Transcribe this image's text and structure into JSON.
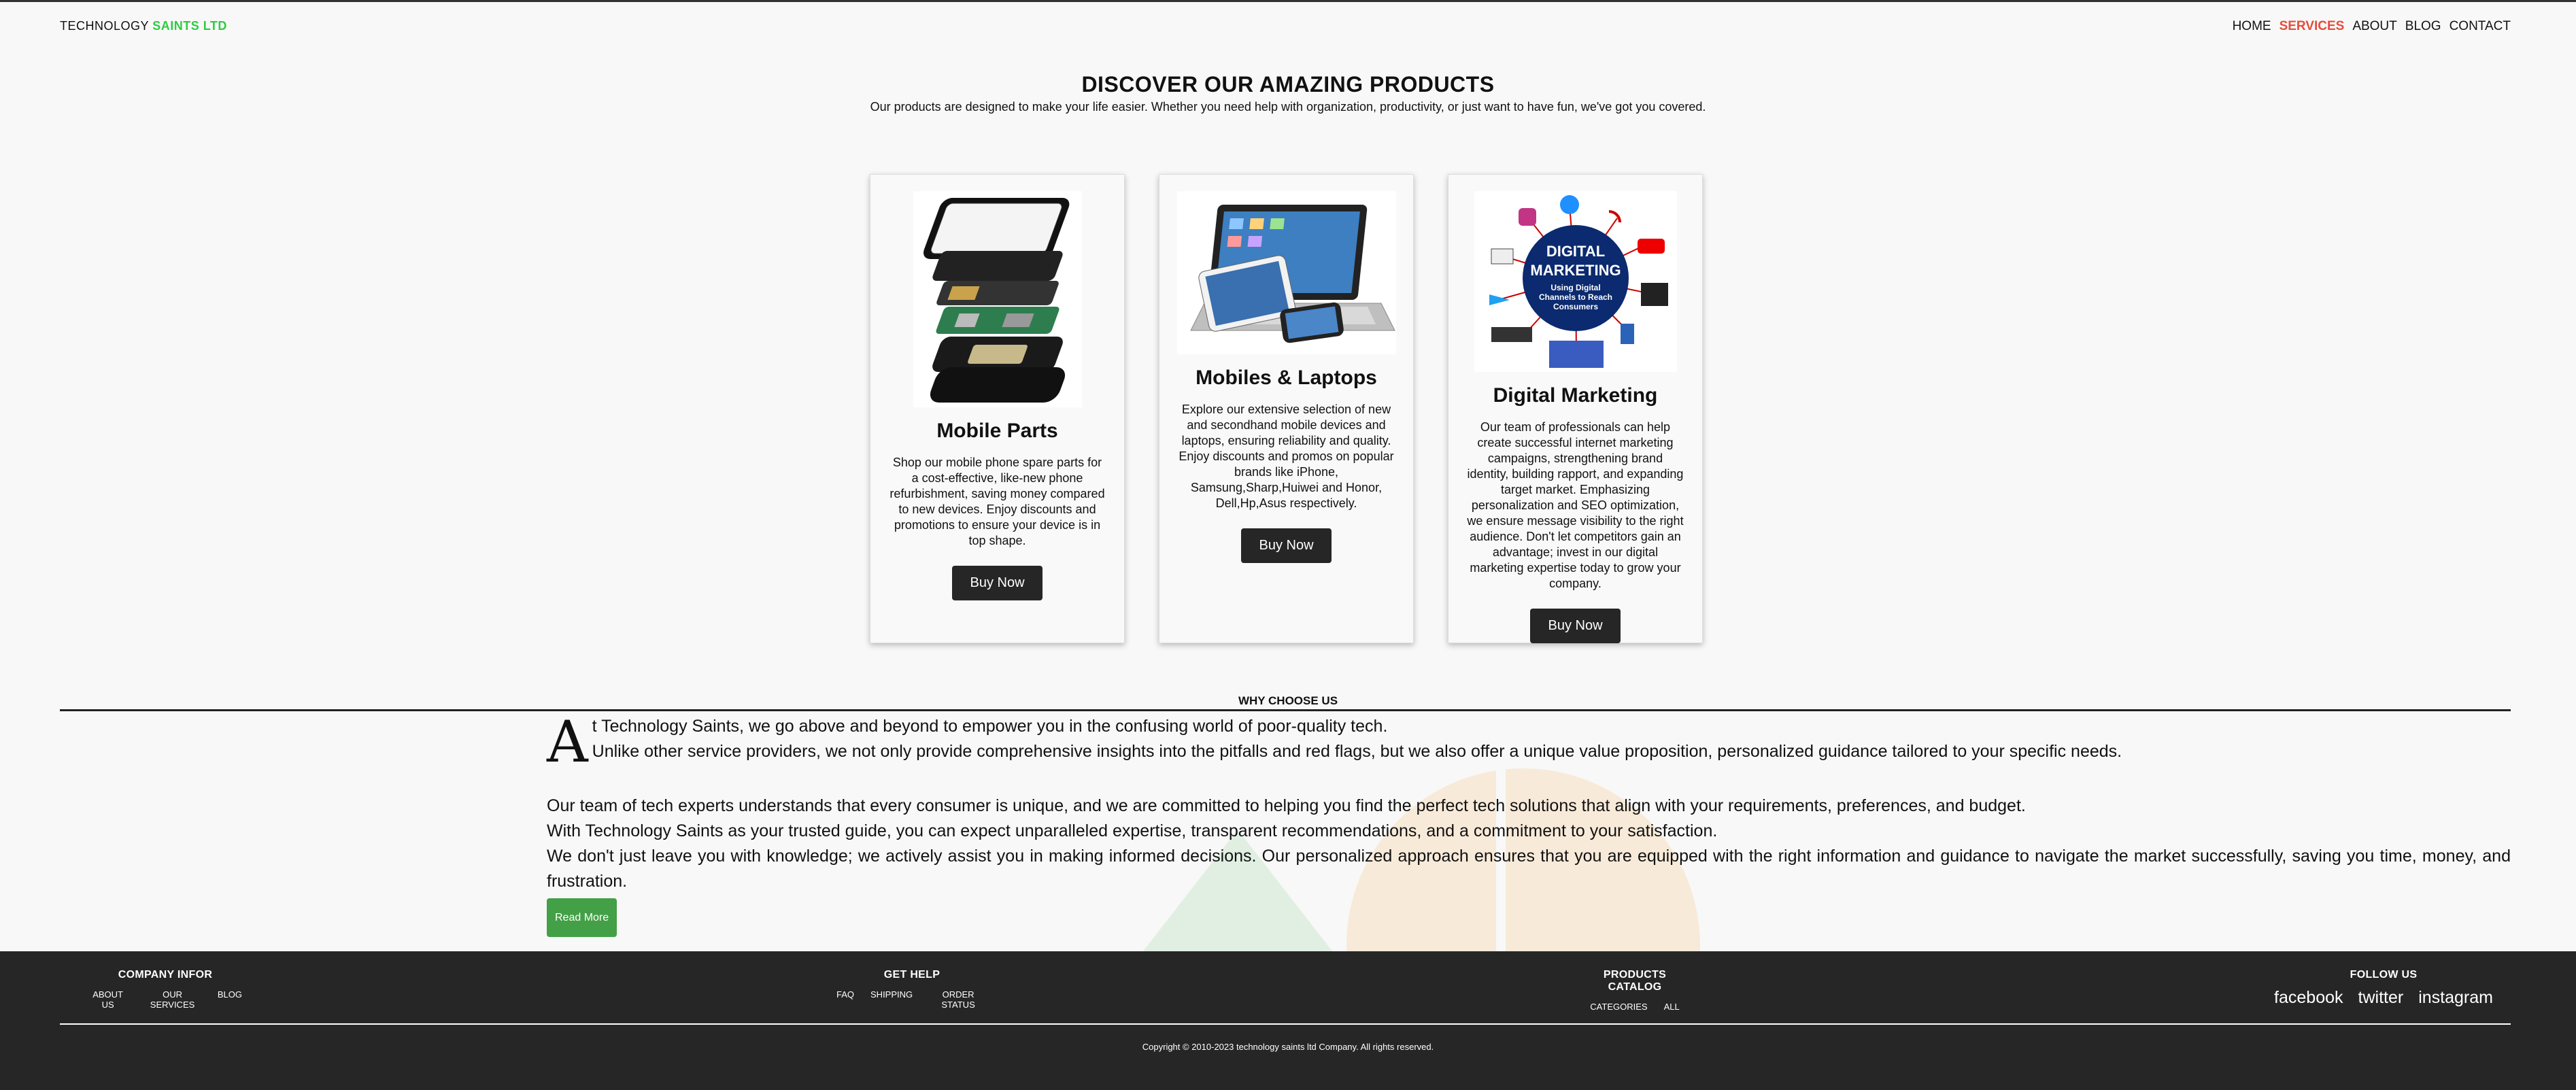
{
  "header": {
    "brand_prefix": "TECHNOLOGY",
    "brand_accent": "SAINTS LTD",
    "nav": [
      "HOME",
      "SERVICES",
      "ABOUT",
      "BLOG",
      "CONTACT"
    ],
    "active_nav": "SERVICES"
  },
  "hero": {
    "title": "DISCOVER OUR AMAZING PRODUCTS",
    "subtitle": "Our products are designed to make your life easier. Whether you need help with organization, productivity, or just want to have fun, we've got you covered."
  },
  "cards": [
    {
      "title": "Mobile Parts",
      "description": "Shop our mobile phone spare parts for a cost-effective, like-new phone refurbishment, saving money compared to new devices. Enjoy discounts and promotions to ensure your device is in top shape.",
      "button": "Buy Now",
      "image_icon": "phone-parts-exploded-icon"
    },
    {
      "title": "Mobiles & Laptops",
      "description": "Explore our extensive selection of new and secondhand mobile devices and laptops, ensuring reliability and quality. Enjoy discounts and promos on popular brands like iPhone, Samsung,Sharp,Huiwei and Honor, Dell,Hp,Asus respectively.",
      "button": "Buy Now",
      "image_icon": "laptop-phone-tablet-icon"
    },
    {
      "title": "Digital Marketing",
      "description": "Our team of professionals can help create successful internet marketing campaigns, strengthening brand identity, building rapport, and expanding target market. Emphasizing personalization and SEO optimization, we ensure message visibility to the right audience. Don't let competitors gain an advantage; invest in our digital marketing expertise today to grow your company.",
      "button": "Buy Now",
      "image_icon": "digital-marketing-diagram-icon",
      "image_text": {
        "line1": "DIGITAL",
        "line2": "MARKETING",
        "line3": "Using Digital",
        "line4": "Channels to Reach",
        "line5": "Consumers"
      }
    }
  ],
  "why": {
    "title": "WHY CHOOSE US",
    "dropcap": "A",
    "p1_rest": "t Technology Saints, we go above and beyond to empower you in the confusing world of poor-quality tech.",
    "p2": "Unlike other service providers, we not only provide comprehensive insights into the pitfalls and red flags, but we also offer a unique value proposition, personalized guidance tailored to your specific needs.",
    "p3": "Our team of tech experts understands that every consumer is unique, and we are committed to helping you find the perfect tech solutions that align with your requirements, preferences, and budget.",
    "p4": "With Technology Saints as your trusted guide, you can expect unparalleled expertise, transparent recommendations, and a commitment to your satisfaction.",
    "p5": "We don't just leave you with knowledge; we actively assist you in making informed decisions. Our personalized approach ensures that you are equipped with the right information and guidance to navigate the market successfully, saving you time, money, and frustration.",
    "read_more": "Read More"
  },
  "footer": {
    "company": {
      "title": "COMPANY INFOR",
      "links": [
        "ABOUT US",
        "OUR SERVICES",
        "BLOG"
      ]
    },
    "help": {
      "title": "GET HELP",
      "links": [
        "FAQ",
        "SHIPPING",
        "ORDER STATUS"
      ]
    },
    "catalog": {
      "title": "PRODUCTS CATALOG",
      "links": [
        "CATEGORIES",
        "ALL"
      ]
    },
    "follow": {
      "title": "FOLLOW US",
      "links": [
        "facebook",
        "twitter",
        "instagram"
      ]
    },
    "copyright": "Copyright © 2010-2023 technology saints ltd Company. All rights reserved."
  },
  "colors": {
    "accent_green": "#2ecc40",
    "active_red": "#e74c3c",
    "button_dark": "#262626",
    "read_more_green": "#43a047",
    "footer_bg": "#262626"
  }
}
